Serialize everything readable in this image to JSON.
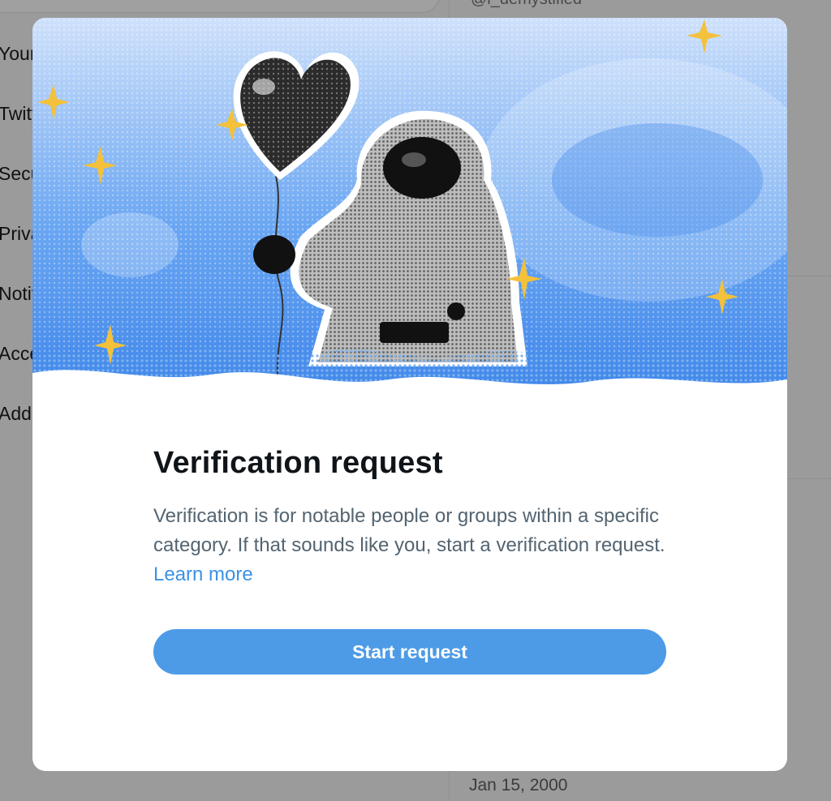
{
  "background": {
    "handle": "@i_demystified",
    "menu_items": [
      "Your",
      "Twitte",
      "Secu",
      "Privac",
      "Notif",
      "Acce",
      "Addit"
    ],
    "date": "Jan 15, 2000"
  },
  "modal": {
    "title": "Verification request",
    "description": "Verification is for notable people or groups within a specific category. If that sounds like you, start a verification request.",
    "learn_more": "Learn more",
    "start_button": "Start request"
  },
  "colors": {
    "accent": "#4d9be6",
    "link": "#3b92e4",
    "title": "#0f1419",
    "body_text": "#536471",
    "hero_sky": "#5b9cf0",
    "sparkle": "#f3c13a"
  },
  "icons": [
    "sparkle-icon",
    "heart-balloon-illustration",
    "astronaut-illustration"
  ]
}
